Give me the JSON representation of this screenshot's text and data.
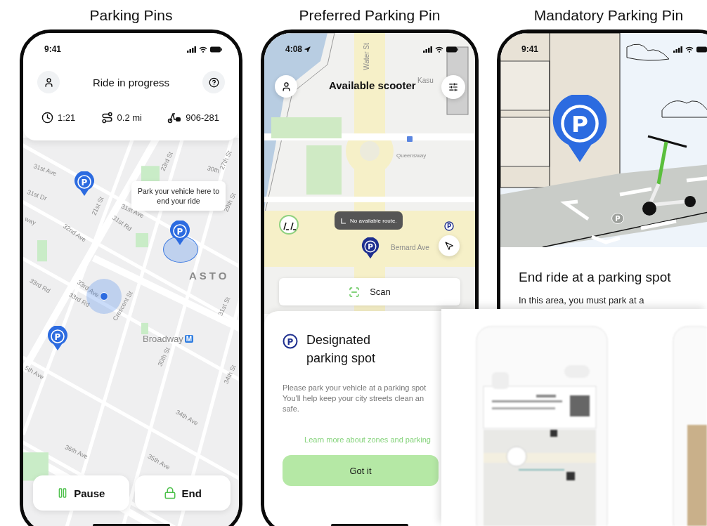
{
  "parking_pins": {
    "heading": "Parking Pins",
    "status_time": "9:41",
    "title": "Ride in progress",
    "stats": [
      {
        "kind": "time",
        "value": "1:21"
      },
      {
        "kind": "distance",
        "value": "0.2 mi"
      },
      {
        "kind": "vehicle",
        "value": "906-281"
      }
    ],
    "map_labels": [
      "31st Ave",
      "31st Dr",
      "23rd St",
      "27th St",
      "30th",
      "29th St",
      "way",
      "32nd Ave",
      "21st St",
      "31st Rd",
      "31st Ave",
      "33rd Rd",
      "33rd Ave",
      "33rd Rd",
      "Crescent St",
      "5th Ave",
      "30th St",
      "31st St",
      "34th St",
      "34th Ave",
      "36th Ave",
      "35th Ave"
    ],
    "district": "ASTO",
    "station": {
      "name": "Broadway",
      "badge": "M"
    },
    "pins": [
      {
        "symbol": "P",
        "target": false
      },
      {
        "symbol": "P",
        "target": true
      },
      {
        "symbol": "P",
        "target": false
      }
    ],
    "tooltip": "Park your vehicle here to end your ride",
    "buttons": [
      {
        "kind": "pause",
        "label": "Pause"
      },
      {
        "kind": "end",
        "label": "End"
      }
    ]
  },
  "preferred_parking_pin": {
    "heading": "Preferred Parking Pin",
    "status_time": "4:08",
    "title": "Available scooter",
    "map_labels": [
      "Water St",
      "Kasu",
      "Queensway",
      "Bernard Ave"
    ],
    "route_tooltip": "No available route.",
    "pin_symbol": "P",
    "side_pin_symbol": "P",
    "scan_button": "Scan",
    "sheet": {
      "symbol": "P",
      "title": "Designated parking spot",
      "body": "Please park your vehicle at a parking spot You'll help keep your city streets clean an safe.",
      "link": "Learn more about zones and parking",
      "button": "Got it"
    }
  },
  "mandatory_parking_pin": {
    "heading": "Mandatory Parking Pin",
    "status_time": "9:41",
    "pin_symbol": "P",
    "ground_symbol": "P",
    "title": "End ride at a parking spot",
    "body": "In this area, you must park at a"
  }
}
